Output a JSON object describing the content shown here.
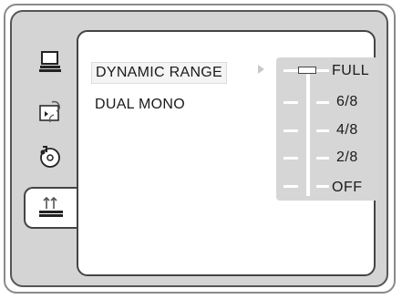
{
  "menu": {
    "items": [
      {
        "label": "DYNAMIC  RANGE",
        "selected": true
      },
      {
        "label": "DUAL  MONO",
        "selected": false
      }
    ]
  },
  "side_tabs": [
    {
      "icon": "monitor-icon",
      "active": false
    },
    {
      "icon": "speech-icon",
      "active": false
    },
    {
      "icon": "disc-icon",
      "active": false
    },
    {
      "icon": "speaker-icon",
      "active": true
    }
  ],
  "dynamic_range": {
    "levels": [
      "FULL",
      "6/8",
      "4/8",
      "2/8",
      "OFF"
    ],
    "current": "FULL"
  }
}
